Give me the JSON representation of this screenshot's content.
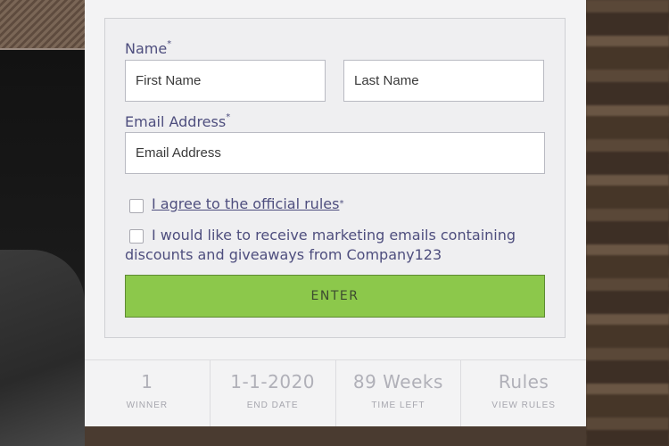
{
  "form": {
    "name_label": "Name",
    "required_mark": "*",
    "first_name_placeholder": "First Name",
    "last_name_placeholder": "Last Name",
    "email_label": "Email Address",
    "email_placeholder": "Email Address",
    "agree_text": "I agree to the official rules",
    "marketing_text_line1": "I would like to receive marketing emails containing",
    "marketing_text_line2": "discounts and giveaways from Company123",
    "enter_label": "ENTER"
  },
  "stats": [
    {
      "value": "1",
      "label": "WINNER"
    },
    {
      "value": "1-1-2020",
      "label": "END DATE"
    },
    {
      "value": "89 Weeks",
      "label": "TIME LEFT"
    },
    {
      "value": "Rules",
      "label": "VIEW RULES"
    }
  ],
  "colors": {
    "accent_button": "#8cc84b",
    "label_text": "#4e4e7e",
    "card_bg": "#f3f3f4"
  }
}
